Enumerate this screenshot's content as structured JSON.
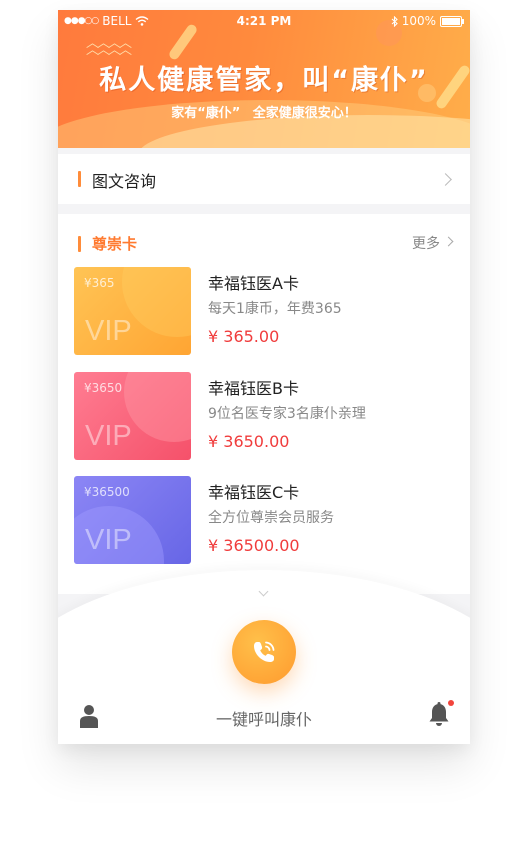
{
  "status_bar": {
    "carrier": "BELL",
    "time": "4:21 PM",
    "battery": "100%"
  },
  "banner": {
    "title": "私人健康管家，叫“康仆”",
    "subtitle": "家有“康仆”  全家健康很安心！"
  },
  "consult": {
    "label": "图文咨询"
  },
  "premium": {
    "title": "尊崇卡",
    "more_label": "更多",
    "cards": [
      {
        "card_price": "¥365",
        "card_vip": "VIP",
        "name": "幸福钰医A卡",
        "desc": "每天1康币，年费365",
        "price": "¥ 365.00",
        "color": "#ffb03d"
      },
      {
        "card_price": "¥3650",
        "card_vip": "VIP",
        "name": "幸福钰医B卡",
        "desc": "9位名医专家3名康仆亲理",
        "price": "¥ 3650.00",
        "color": "#f7627a"
      },
      {
        "card_price": "¥36500",
        "card_vip": "VIP",
        "name": "幸福钰医C卡",
        "desc": "全方位尊崇会员服务",
        "price": "¥ 36500.00",
        "color": "#7a76ee"
      }
    ]
  },
  "bottom": {
    "call_label": "一键呼叫康仆"
  },
  "colors": {
    "accent": "#ff8c3a",
    "price_red": "#f03c3c",
    "notification_dot": "#f2443c"
  },
  "icons": {
    "wifi": "wifi-icon",
    "bluetooth": "bluetooth-icon",
    "battery": "battery-icon",
    "chevron": "chevron-right-icon",
    "phone": "phone-icon",
    "profile": "person-icon",
    "bell": "bell-icon"
  }
}
